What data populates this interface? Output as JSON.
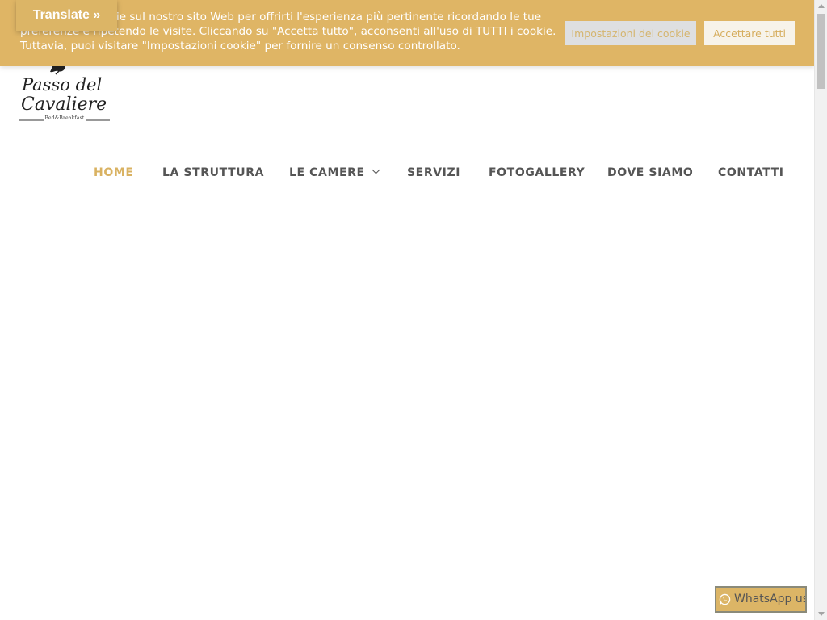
{
  "translate": {
    "label": "Translate »"
  },
  "cookie": {
    "text": "Utilizziamo i cookie sul nostro sito Web per offrirti l'esperienza più pertinente ricordando le tue preferenze e ripetendo le visite. Cliccando su \"Accetta tutto\", acconsenti all'uso di TUTTI i cookie. Tuttavia, puoi visitare \"Impostazioni cookie\" per fornire un consenso controllato.",
    "settings_label": "Impostazioni dei cookie",
    "accept_label": "Accettare tutti"
  },
  "logo": {
    "line1": "Passo del",
    "line2": "Cavaliere",
    "tagline": "Bed&Breakfast"
  },
  "nav": {
    "items": [
      {
        "label": "HOME",
        "active": true
      },
      {
        "label": "LA STRUTTURA"
      },
      {
        "label": "LE CAMERE",
        "has_submenu": true
      },
      {
        "label": "SERVIZI"
      },
      {
        "label": "FOTOGALLERY"
      },
      {
        "label": "DOVE SIAMO"
      },
      {
        "label": "CONTATTI"
      }
    ]
  },
  "whatsapp": {
    "label": "WhatsApp us",
    "icon": "whatsapp-icon"
  },
  "colors": {
    "accent": "#dfb565",
    "nav_text": "#555555",
    "nav_active": "#d9b262"
  }
}
